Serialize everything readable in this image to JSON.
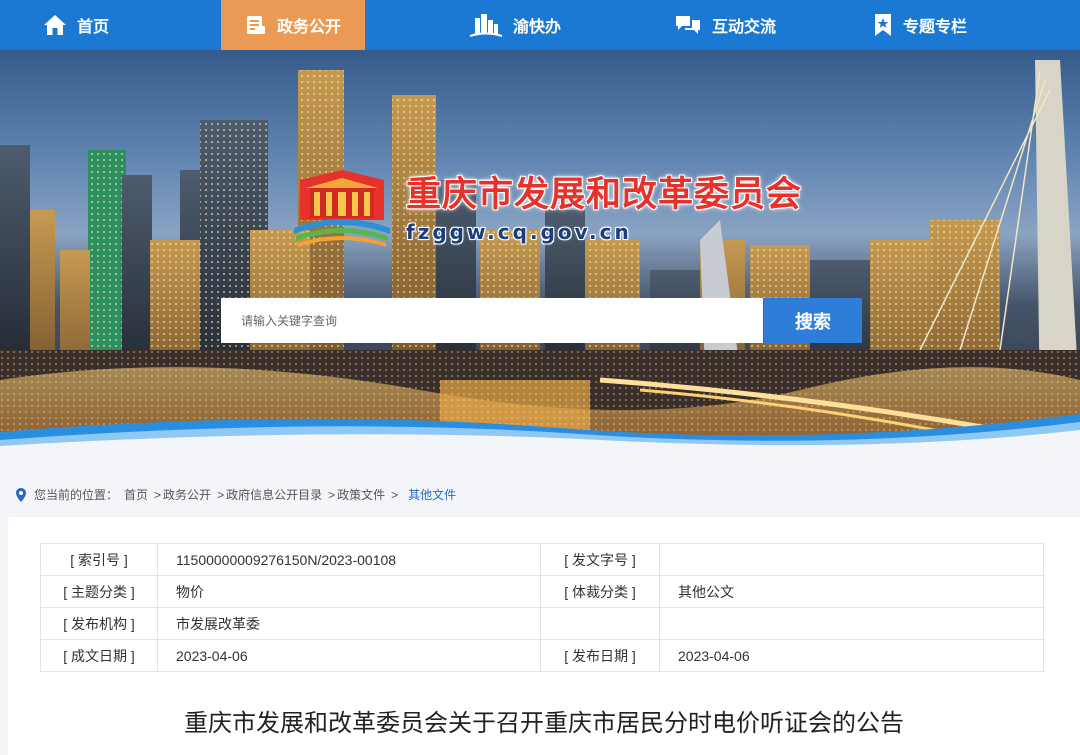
{
  "nav": {
    "items": [
      {
        "label": "首页",
        "icon": "home-icon"
      },
      {
        "label": "政务公开",
        "icon": "document-icon",
        "active": true
      },
      {
        "label": "渝快办",
        "icon": "building-icon"
      },
      {
        "label": "互动交流",
        "icon": "chat-icon"
      },
      {
        "label": "专题专栏",
        "icon": "bookmark-star-icon"
      }
    ]
  },
  "header": {
    "site_name": "重庆市发展和改革委员会",
    "domain": "fzggw.cq.gov.cn"
  },
  "search": {
    "placeholder": "请输入关键字查询",
    "button_label": "搜索"
  },
  "breadcrumb": {
    "prefix": "您当前的位置：",
    "items": [
      "首页",
      "政务公开",
      "政府信息公开目录",
      "政策文件"
    ],
    "current": "其他文件"
  },
  "meta_table": {
    "rows": [
      {
        "k1": "[ 索引号 ]",
        "v1": "11500000009276150N/2023-00108",
        "k2": "[ 发文字号 ]",
        "v2": ""
      },
      {
        "k1": "[ 主题分类 ]",
        "v1": "物价",
        "k2": "[ 体裁分类 ]",
        "v2": "其他公文"
      },
      {
        "k1": "[ 发布机构 ]",
        "v1": "市发展改革委",
        "k2": "",
        "v2": ""
      },
      {
        "k1": "[ 成文日期 ]",
        "v1": "2023-04-06",
        "k2": "[ 发布日期 ]",
        "v2": "2023-04-06"
      }
    ]
  },
  "document": {
    "title": "重庆市发展和改革委员会关于召开重庆市居民分时电价听证会的公告"
  },
  "colors": {
    "nav_bg": "#1b79d3",
    "nav_active": "#eb9a55",
    "search_button": "#2e7ed9",
    "site_name": "#e6322b",
    "current_crumb": "#2a68c4"
  }
}
